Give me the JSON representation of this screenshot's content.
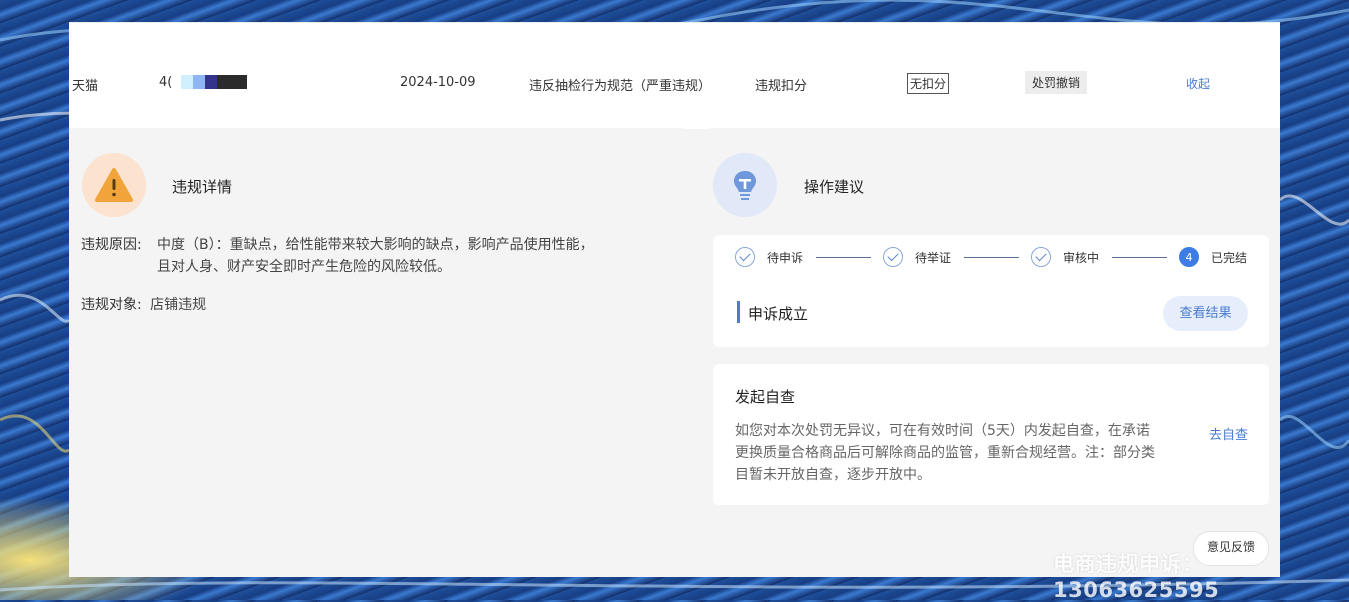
{
  "row": {
    "platform": "天猫",
    "id_prefix": "4(",
    "date": "2024-10-09",
    "violation_type": "违反抽检行为规范（严重违规）",
    "penalty_type": "违规扣分",
    "deduction_tag": "无扣分",
    "status_tag": "处罚撤销",
    "collapse_link": "收起"
  },
  "details": {
    "title": "违规详情",
    "reason_label": "违规原因:",
    "reason_value_line1": "中度（B）：重缺点，给性能带来较大影响的缺点，影响产品使用性能，",
    "reason_value_line2": "且对人身、财产安全即时产生危险的风险较低。",
    "target_label": "违规对象:",
    "target_value": "店铺违规"
  },
  "advice": {
    "title": "操作建议",
    "steps": [
      {
        "label": "待申诉",
        "state": "done"
      },
      {
        "label": "待举证",
        "state": "done"
      },
      {
        "label": "审核中",
        "state": "done"
      },
      {
        "label": "已完结",
        "state": "current",
        "number": "4"
      }
    ],
    "result_text": "申诉成立",
    "result_button": "查看结果"
  },
  "self_check": {
    "title": "发起自查",
    "description": "如您对本次处罚无异议，可在有效时间（5天）内发起自查，在承诺更换质量合格商品后可解除商品的监管，重新合规经营。注：部分类目暂未开放自查，逐步开放中。",
    "link": "去自查"
  },
  "feedback_button": "意见反馈",
  "watermark": "电商违规申诉：13063625595",
  "colors": {
    "accent": "#4a7bd0",
    "warning_bg": "#fbe3d0",
    "warning_icon": "#f0a43a",
    "step_current": "#3d7de5"
  }
}
